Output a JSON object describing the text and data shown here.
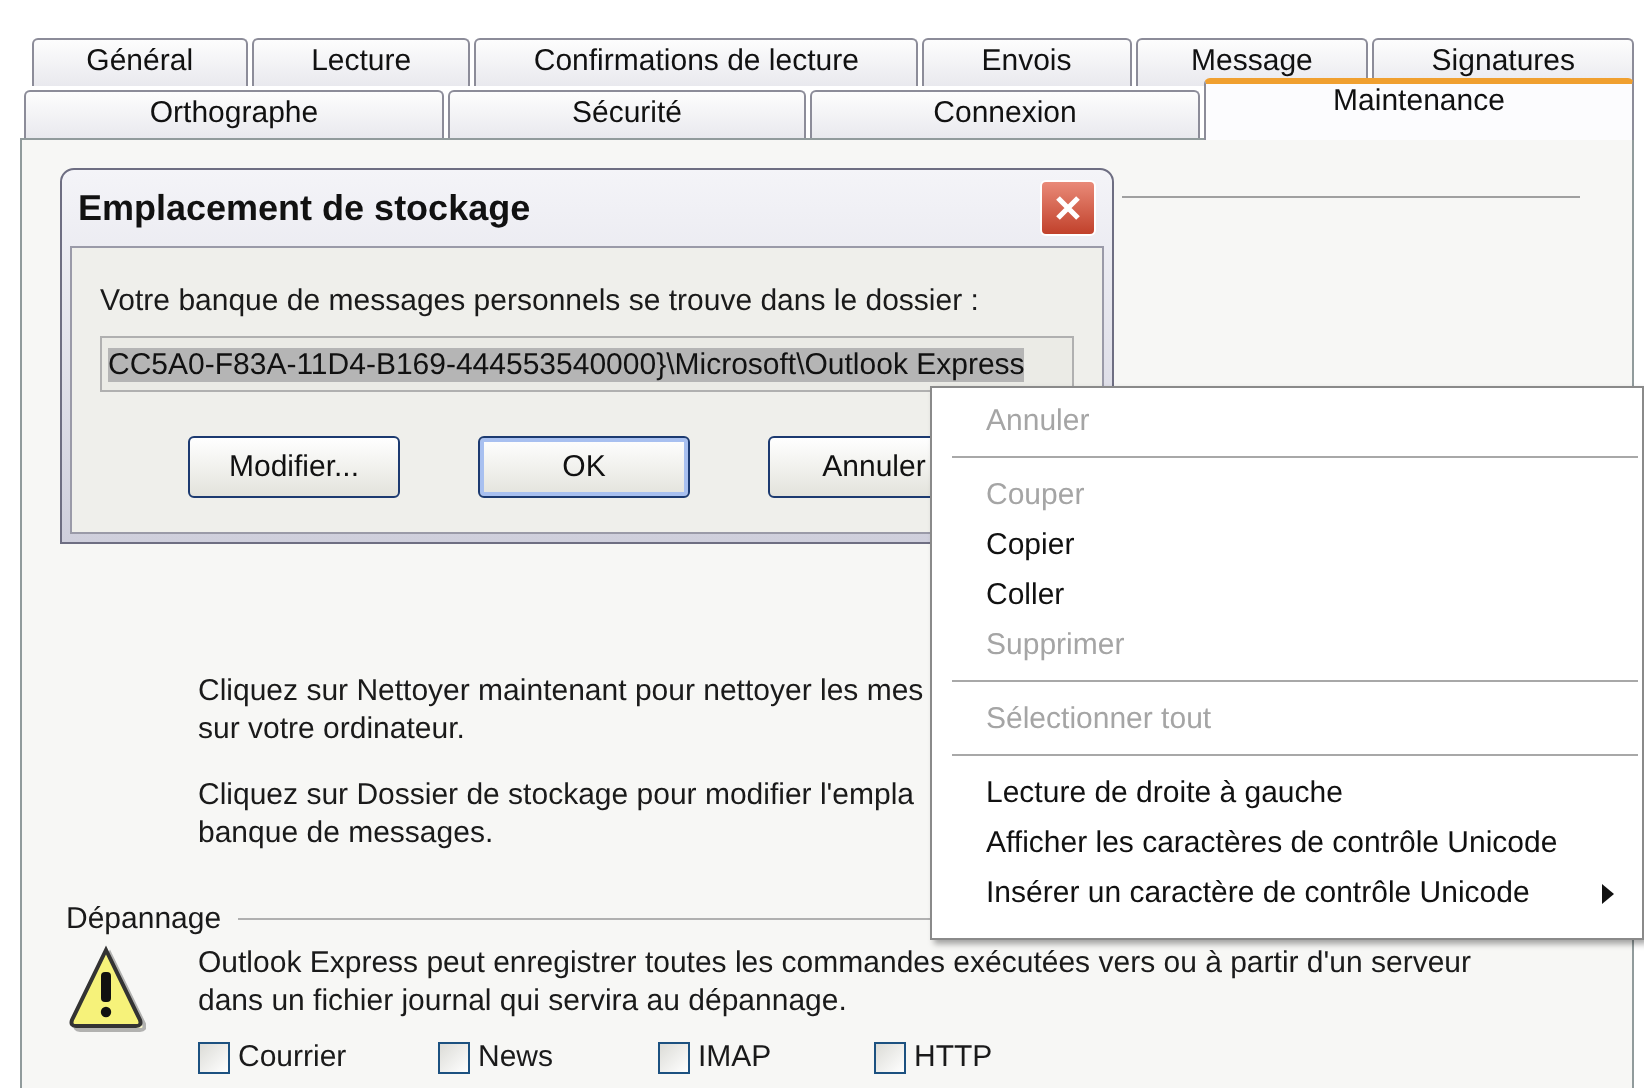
{
  "tabs_row_1": [
    {
      "label": "Général",
      "selected": false
    },
    {
      "label": "Lecture",
      "selected": false
    },
    {
      "label": "Confirmations de lecture",
      "selected": false
    },
    {
      "label": "Envois",
      "selected": false
    },
    {
      "label": "Message",
      "selected": false
    },
    {
      "label": "Signatures",
      "selected": false
    }
  ],
  "tabs_row_2": [
    {
      "label": "Orthographe",
      "selected": false
    },
    {
      "label": "Sécurité",
      "selected": false
    },
    {
      "label": "Connexion",
      "selected": false
    },
    {
      "label": "Maintenance",
      "selected": true
    }
  ],
  "panel": {
    "paragraphs": [
      [
        "Cliquez sur Nettoyer maintenant pour nettoyer les mes",
        "sur votre ordinateur."
      ],
      [
        "Cliquez sur Dossier de stockage pour modifier l'empla",
        "banque de messages."
      ]
    ],
    "troubleshooting": {
      "title": "Dépannage",
      "text": "Outlook Express peut enregistrer toutes les commandes exécutées vers ou à partir d'un serveur dans un fichier journal qui servira au dépannage.",
      "options": [
        {
          "label": "Courrier",
          "checked": false
        },
        {
          "label": "News",
          "checked": false
        },
        {
          "label": "IMAP",
          "checked": false
        },
        {
          "label": "HTTP",
          "checked": false
        }
      ]
    }
  },
  "dialog": {
    "title": "Emplacement de stockage",
    "message": "Votre banque de messages personnels se trouve dans le dossier :",
    "path": "CC5A0-F83A-11D4-B169-444553540000}\\Microsoft\\Outlook Express",
    "buttons": [
      {
        "label": "Modifier...",
        "default": false
      },
      {
        "label": "OK",
        "default": true
      },
      {
        "label": "Annuler",
        "default": false
      }
    ]
  },
  "context_menu": {
    "groups": [
      [
        {
          "label": "Annuler",
          "disabled": true,
          "submenu": false
        }
      ],
      [
        {
          "label": "Couper",
          "disabled": true,
          "submenu": false
        },
        {
          "label": "Copier",
          "disabled": false,
          "submenu": false
        },
        {
          "label": "Coller",
          "disabled": false,
          "submenu": false
        },
        {
          "label": "Supprimer",
          "disabled": true,
          "submenu": false
        }
      ],
      [
        {
          "label": "Sélectionner tout",
          "disabled": true,
          "submenu": false
        }
      ],
      [
        {
          "label": "Lecture de droite à gauche",
          "disabled": false,
          "submenu": false
        },
        {
          "label": "Afficher les caractères de contrôle Unicode",
          "disabled": false,
          "submenu": false
        },
        {
          "label": "Insérer un caractère de contrôle Unicode",
          "disabled": false,
          "submenu": true
        }
      ]
    ]
  }
}
